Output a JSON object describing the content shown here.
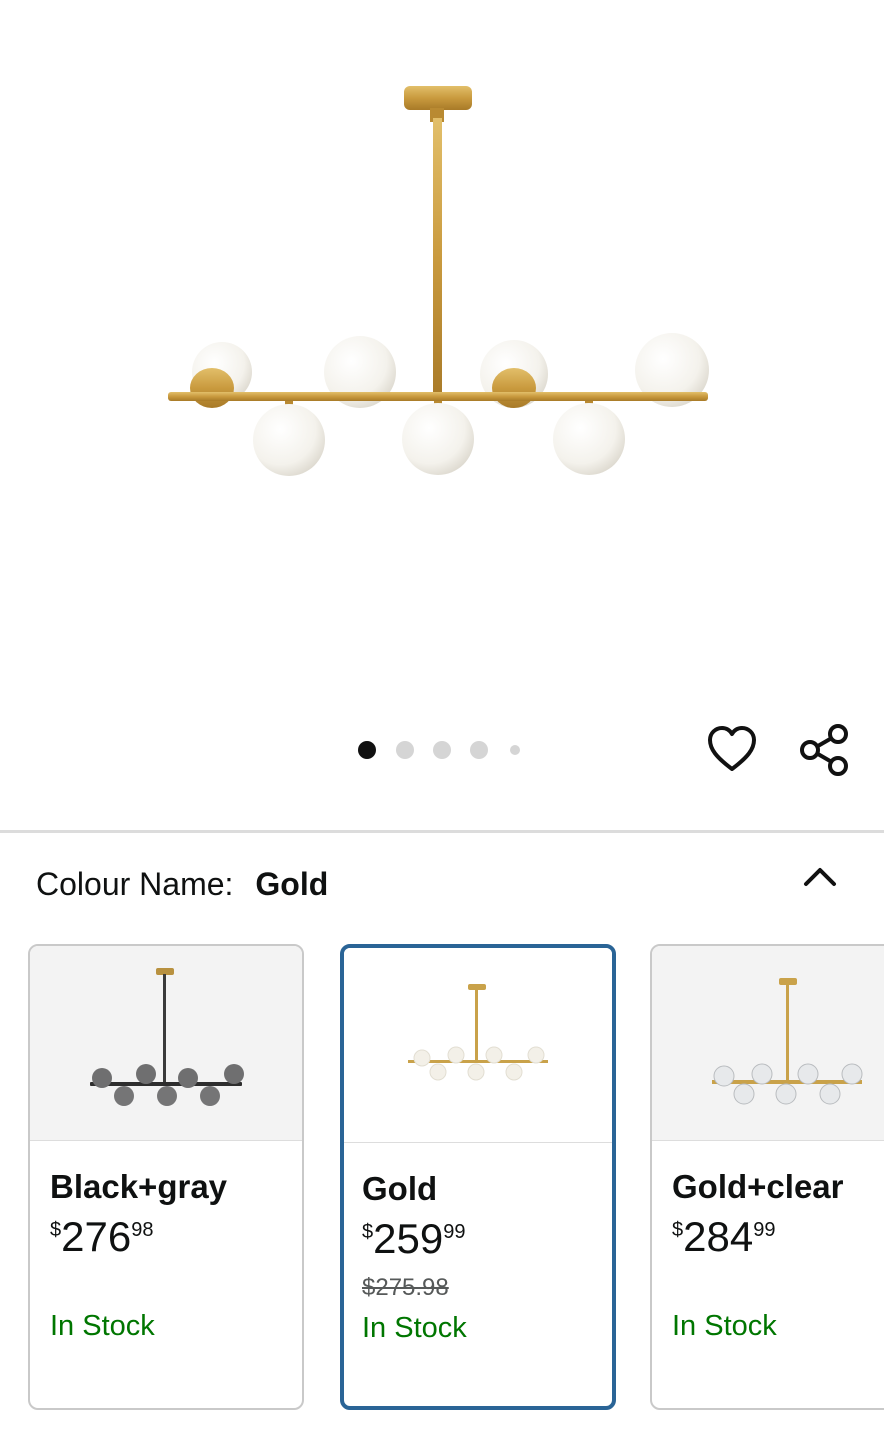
{
  "hero": {
    "image_alt": "Gold sputnik chandelier with white glass globes",
    "carousel": {
      "count": 5,
      "active": 0
    }
  },
  "actions": {
    "wishlist_icon": "heart-icon",
    "share_icon": "share-icon"
  },
  "colour": {
    "label": "Colour Name:",
    "value": "Gold",
    "toggle_icon": "chevron-up-icon"
  },
  "variants": [
    {
      "name": "Black+gray",
      "currency": "$",
      "whole": "276",
      "fraction": "98",
      "was": "",
      "stock": "In Stock",
      "selected": false
    },
    {
      "name": "Gold",
      "currency": "$",
      "whole": "259",
      "fraction": "99",
      "was": "$275.98",
      "stock": "In Stock",
      "selected": true
    },
    {
      "name": "Gold+clear",
      "currency": "$",
      "whole": "284",
      "fraction": "99",
      "was": "",
      "stock": "In Stock",
      "selected": false
    }
  ],
  "colors": {
    "selected_border": "#2a6496",
    "in_stock": "#007600",
    "brass": "#c9a24a"
  }
}
